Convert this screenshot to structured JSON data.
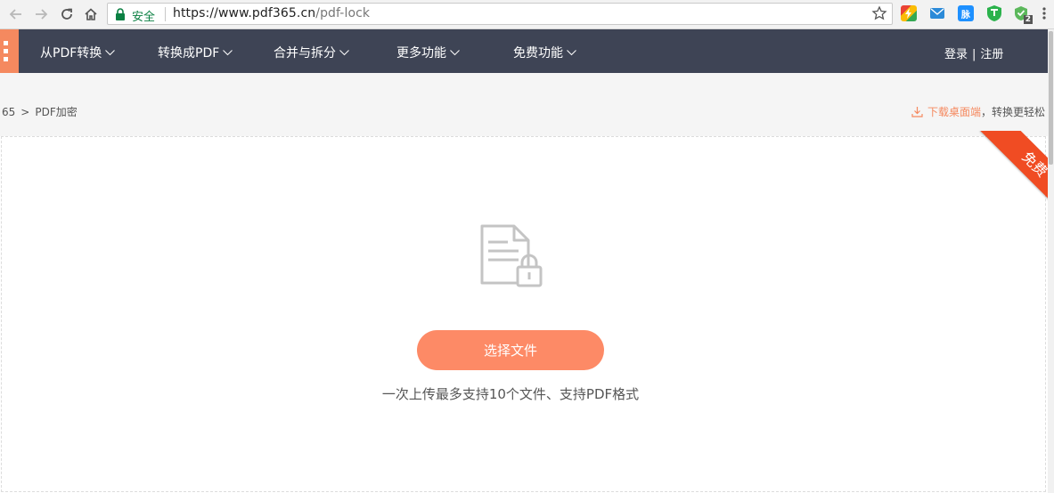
{
  "browser": {
    "secure_label": "安全",
    "url_host": "https://www.pdf365.cn",
    "url_path": "/pdf-lock",
    "extensions": [
      {
        "name": "ext-chrome-icon",
        "color": "#f4b400"
      },
      {
        "name": "mail-icon",
        "color": "#2b8ad8"
      },
      {
        "name": "ext-mai-icon",
        "color": "#1e90ff",
        "label": "脉"
      },
      {
        "name": "shield-icon",
        "color": "#2bb24c"
      },
      {
        "name": "ext-badge-icon",
        "color": "#5cb85c",
        "badge": "2"
      }
    ]
  },
  "nav": {
    "items": [
      {
        "label": "从PDF转换"
      },
      {
        "label": "转换成PDF"
      },
      {
        "label": "合并与拆分"
      },
      {
        "label": "更多功能"
      },
      {
        "label": "免费功能"
      }
    ],
    "login": "登录",
    "separator": "|",
    "register": "注册",
    "colors": {
      "bar": "#3e4455",
      "accent": "#f5895f"
    }
  },
  "breadcrumb": {
    "prefix": "65",
    "arrow": ">",
    "current": "PDF加密"
  },
  "download": {
    "link": "下载桌面端",
    "tail": "，转换更轻松"
  },
  "upload": {
    "ribbon": "免费",
    "button": "选择文件",
    "hint": "一次上传最多支持10个文件、支持PDF格式",
    "icon": "document-lock-icon",
    "button_color": "#fd8a66",
    "ribbon_color": "#f04c23"
  }
}
